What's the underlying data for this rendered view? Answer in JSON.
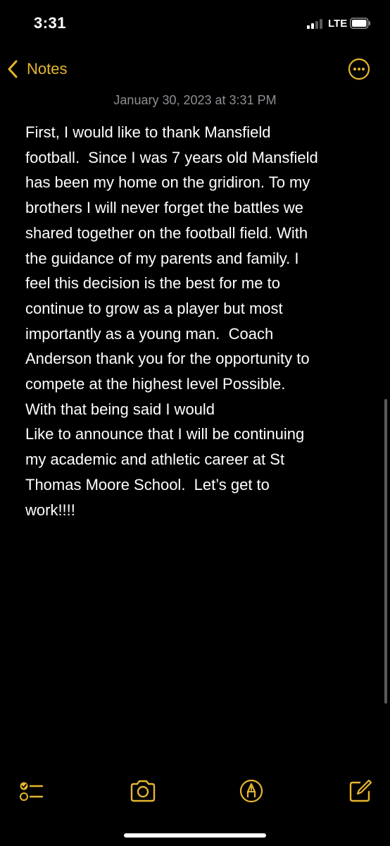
{
  "status_bar": {
    "time": "3:31",
    "network": "LTE"
  },
  "nav": {
    "back_label": "Notes",
    "back_icon": "chevron-left-icon",
    "more_icon": "ellipsis-circle-icon"
  },
  "note": {
    "date": "January 30, 2023 at 3:31 PM",
    "lines": [
      "First, I would like to thank Mansfield",
      "football.  Since I was 7 years old Mansfield",
      "has been my home on the gridiron. To my",
      "brothers I will never forget the battles we",
      "shared together on the football field. With",
      "the guidance of my parents and family. I",
      "feel this decision is the best for me to",
      "continue to grow as a player but most",
      "importantly as a young man.  Coach",
      "Anderson thank you for the opportunity to",
      "compete at the highest level Possible.",
      "With that being said I would",
      "Like to announce that I will be continuing",
      "my academic and athletic career at St",
      "Thomas Moore School.  Let’s get to",
      "work!!!!"
    ]
  },
  "toolbar": {
    "checklist_icon": "checklist-icon",
    "camera_icon": "camera-icon",
    "markup_icon": "markup-pen-icon",
    "compose_icon": "compose-icon"
  },
  "colors": {
    "accent": "#e5b62f",
    "background": "#000000",
    "text": "#ffffff",
    "date_text": "#8e8e93"
  }
}
